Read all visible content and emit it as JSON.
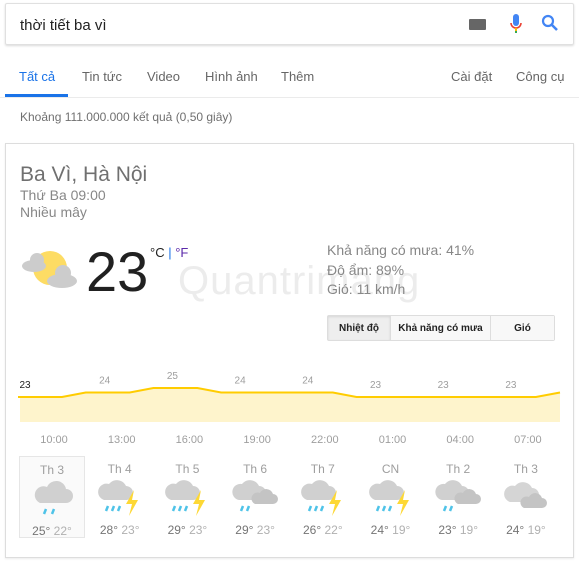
{
  "search": {
    "query": "thời tiết ba vì",
    "icons": [
      "keyboard-icon",
      "mic-icon",
      "search-icon"
    ]
  },
  "tabs": [
    {
      "label": "Tất cả",
      "active": true
    },
    {
      "label": "Tin tức"
    },
    {
      "label": "Video"
    },
    {
      "label": "Hình ảnh"
    },
    {
      "label": "Thêm"
    }
  ],
  "tools": {
    "settings": "Cài đặt",
    "tools": "Công cụ"
  },
  "stats": "Khoảng 111.000.000 kết quả (0,50 giây)",
  "weather": {
    "location": "Ba Vì, Hà Nội",
    "time": "Thứ Ba 09:00",
    "condition": "Nhiều mây",
    "temp": "23",
    "unit_c": "°C",
    "unit_sep": "|",
    "unit_f": "°F",
    "precip": "Khả năng có mưa: 41%",
    "humidity": "Độ ẩm: 89%",
    "wind": "Gió: 11 km/h",
    "buttons": [
      {
        "label": "Nhiệt độ",
        "active": true
      },
      {
        "label": "Khả năng có mưa"
      },
      {
        "label": "Gió"
      }
    ],
    "watermark": "Quantrimang",
    "colors": {
      "line": "#ffcc00",
      "fill": "#fef4cc",
      "accent": "#1a73e8"
    },
    "days": [
      {
        "name": "Th 3",
        "icon": "rain-icon",
        "hi": "25°",
        "lo": "22°",
        "selected": true
      },
      {
        "name": "Th 4",
        "icon": "thunderstorm-icon",
        "hi": "28°",
        "lo": "23°"
      },
      {
        "name": "Th 5",
        "icon": "thunderstorm-icon",
        "hi": "29°",
        "lo": "23°"
      },
      {
        "name": "Th 6",
        "icon": "cloudy-rain-icon",
        "hi": "29°",
        "lo": "23°"
      },
      {
        "name": "Th 7",
        "icon": "thunderstorm-icon",
        "hi": "26°",
        "lo": "22°"
      },
      {
        "name": "CN",
        "icon": "thunderstorm-icon",
        "hi": "24°",
        "lo": "19°"
      },
      {
        "name": "Th 2",
        "icon": "cloudy-rain-icon",
        "hi": "23°",
        "lo": "19°"
      },
      {
        "name": "Th 3",
        "icon": "cloudy-icon",
        "hi": "24°",
        "lo": "19°"
      }
    ]
  },
  "chart_data": {
    "type": "area",
    "x": [
      "10:00",
      "13:00",
      "16:00",
      "19:00",
      "22:00",
      "01:00",
      "04:00",
      "07:00"
    ],
    "values": [
      23,
      24,
      25,
      24,
      24,
      23,
      23,
      23
    ],
    "labels": [
      "23",
      "24",
      "25",
      "24",
      "24",
      "23",
      "23",
      "23"
    ]
  }
}
